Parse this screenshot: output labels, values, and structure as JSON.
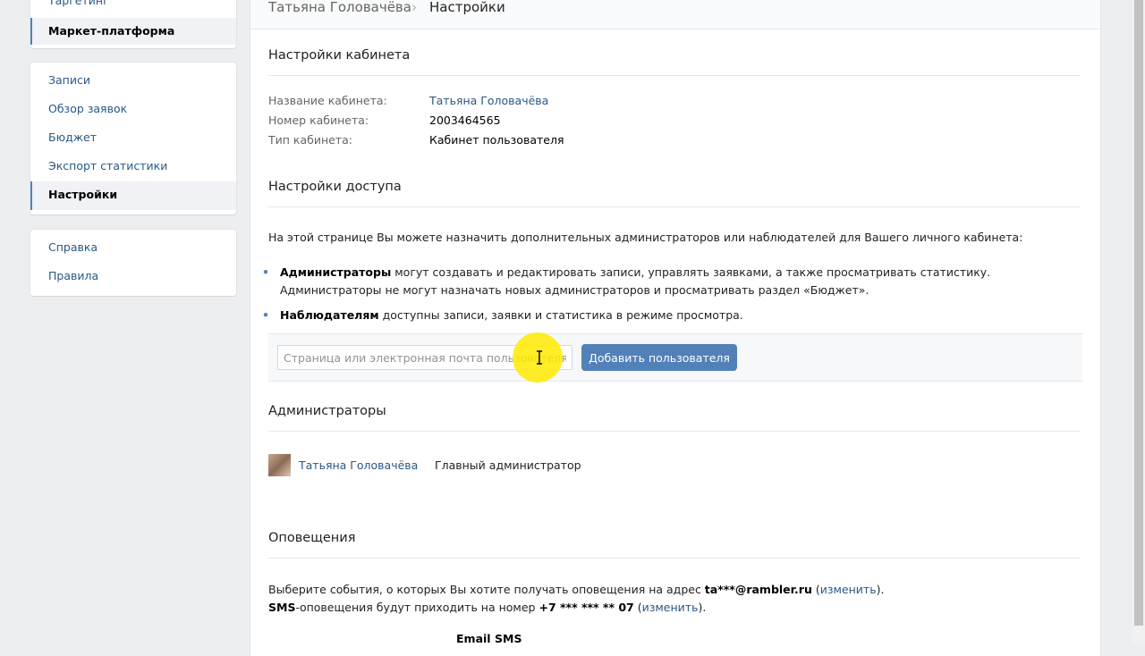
{
  "sidebar": {
    "block1": [
      {
        "label": "Таргетинг",
        "active": false
      },
      {
        "label": "Маркет-платформа",
        "active": true
      }
    ],
    "block2": [
      {
        "label": "Записи",
        "active": false
      },
      {
        "label": "Обзор заявок",
        "active": false
      },
      {
        "label": "Бюджет",
        "active": false
      },
      {
        "label": "Экспорт статистики",
        "active": false
      },
      {
        "label": "Настройки",
        "active": true
      }
    ],
    "block3": [
      {
        "label": "Справка",
        "active": false
      },
      {
        "label": "Правила",
        "active": false
      }
    ]
  },
  "breadcrumb": {
    "parent": "Татьяна Головачёва",
    "separator": "›",
    "current": "Настройки"
  },
  "cabinet": {
    "title": "Настройки кабинета",
    "name_key": "Название кабинета:",
    "name_value": "Татьяна Головачёва",
    "number_key": "Номер кабинета:",
    "number_value": "2003464565",
    "type_key": "Тип кабинета:",
    "type_value": "Кабинет пользователя"
  },
  "access": {
    "title": "Настройки доступа",
    "intro": "На этой странице Вы можете назначить дополнительных администраторов или наблюдателей для Вашего личного кабинета:",
    "admins_bold": "Администраторы",
    "admins_text1": " могут создавать и редактировать записи, управлять заявками, а также просматривать статистику.",
    "admins_text2": "Администраторы не могут назначать новых администраторов и просматривать раздел «Бюджет».",
    "observers_bold": "Наблюдателям",
    "observers_text": " доступны записи, заявки и статистика в режиме просмотра.",
    "input_placeholder": "Страница или электронная почта пользователя",
    "input_value": "",
    "add_button": "Добавить пользователя"
  },
  "administrators": {
    "title": "Администраторы",
    "list": [
      {
        "name": "Татьяна Головачёва",
        "role": "Главный администратор"
      }
    ]
  },
  "notifications": {
    "title": "Оповещения",
    "line1_prefix": "Выберите события, о которых Вы хотите получать оповещения на адрес ",
    "line1_email": "ta***@rambler.ru",
    "line1_open": " (",
    "line1_change": "изменить",
    "line1_close": ").",
    "line2_sms": "SMS",
    "line2_prefix": "-оповещения будут приходить на номер ",
    "line2_phone": "+7 *** *** ** 07",
    "line2_open": " (",
    "line2_change": "изменить",
    "line2_close": ").",
    "col_email": "Email",
    "col_sms": "SMS"
  },
  "colors": {
    "accent": "#5181b8",
    "link": "#2a5885",
    "page_bg": "#edeef0",
    "cursor_highlight": "#ffeb00"
  },
  "icons": {
    "breadcrumb_separator": "chevron-right-icon",
    "text_cursor": "text-cursor-icon"
  }
}
